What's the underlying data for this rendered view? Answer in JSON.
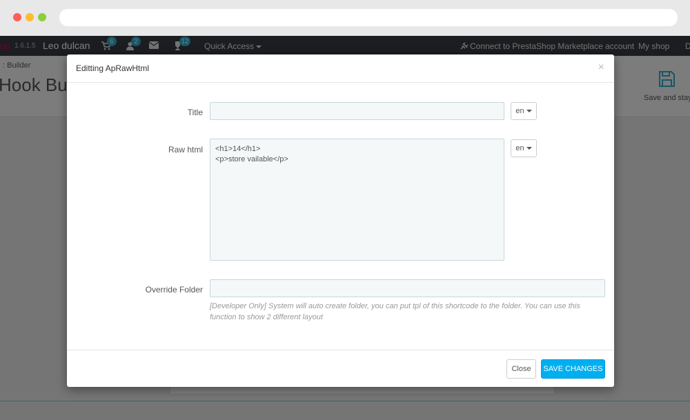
{
  "topbar": {
    "logo_fragment": "op",
    "version": "1.6.1.5",
    "user": "Leo dulcan",
    "notifications": {
      "orders": "6",
      "customers": "2",
      "messages_icon": "envelope-icon",
      "trophy": "12"
    },
    "quick_access": "Quick Access",
    "connect": "Connect to PrestaShop Marketplace account",
    "my_shop": "My shop",
    "truncated": "D"
  },
  "page": {
    "breadcrumb": ": Builder",
    "title": "Hook Bui",
    "save_and_stay": "Save and stay"
  },
  "modal": {
    "title": "Editting ApRawHtml",
    "close_symbol": "×",
    "fields": {
      "title_label": "Title",
      "title_value": "",
      "title_lang": "en",
      "raw_html_label": "Raw html",
      "raw_html_value": "<h1>14</h1>\n<p>store vailable</p>",
      "raw_html_lang": "en",
      "override_label": "Override Folder",
      "override_value": "",
      "override_help": "[Developer Only] System will auto create folder, you can put tpl of this shortcode to the folder. You can use this function to show 2 different layout"
    },
    "footer": {
      "close_label": "Close",
      "save_label": "SAVE CHANGES"
    }
  },
  "colors": {
    "topbar_bg": "#363a41",
    "badge": "#2eacce",
    "primary_button": "#00aff0",
    "brand_pink": "#df0067"
  }
}
